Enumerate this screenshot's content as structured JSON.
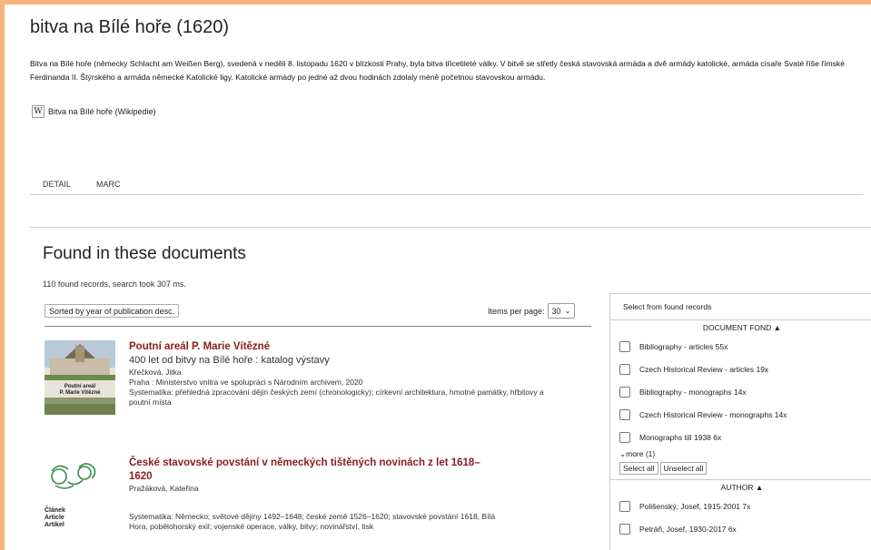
{
  "header": {
    "title": "bitva na Bílé hoře (1620)",
    "description": "Bitva na Bílé hoře (německy Schlacht am Weißen Berg), svedená v neděli 8. listopadu 1620 v blízkosti Prahy, byla bitva třicetileté války. V bitvě se střetly česká stavovská armáda a dvě armády katolické, armáda císaře Svaté říše římské Ferdinanda II. Štýrského a armáda německé Katolické ligy. Katolické armády po jedné až dvou hodinách zdolaly méně početnou stavovskou armádu.",
    "wiki_icon": "W",
    "wiki_link": "Bitva na Bílé hoře (Wikipedie)"
  },
  "tabs": [
    "DETAIL",
    "MARC"
  ],
  "found": {
    "title": "Found in these documents",
    "count_text": "110 found records, search took 307 ms.",
    "sort_label": "Sorted by year of publication desc.",
    "items_per_page_label": "Items per page:",
    "items_per_page_value": "30"
  },
  "records": [
    {
      "title": "Poutní areál P. Marie Vítězné",
      "subtitle": "400 let od bitvy na Bílé hoře : katalog výstavy",
      "author": "Křečková, Jitka",
      "publisher": "Praha : Ministerstvo vnitra ve spolupráci s Národním archivem, 2020",
      "systematics": "Systematika: přehledná zpracování dějin českých zemí (chronologicky); církevní architektura, hmotné památky, hřbitovy a poutní místa",
      "thumb_text": [
        "Poutní areál",
        "P. Marie Vítězné"
      ]
    },
    {
      "title": "České stavovské povstání v německých tištěných novinách z let 1618–1620",
      "author": "Pražáková, Kateřina",
      "systematics": "Systematika: Německo; světové dějiny 1492–1648; české země 1526–1620; stavovské povstání 1618, Bílá Hora, pobělohorský exil; vojenské operace, války, bitvy; novinářství, tisk",
      "type_labels": [
        "Článek",
        "Article",
        "Artikel"
      ]
    }
  ],
  "panel": {
    "header": "Select from found records",
    "fond_title": "DOCUMENT FOND ▲",
    "fond_items": [
      "Bibliography - articles 55x",
      "Czech Historical Review - articles 19x",
      "Bibliography - monographs 14x",
      "Czech Historical Review - monographs 14x",
      "Monographs till 1938 6x"
    ],
    "more": "more (1)",
    "select_all": "Select all",
    "unselect_all": "Unselect all",
    "author_title": "AUTHOR ▲",
    "author_items": [
      "Polišenský, Josef, 1915-2001 7x",
      "Petráň, Josef, 1930-2017 6x"
    ]
  }
}
